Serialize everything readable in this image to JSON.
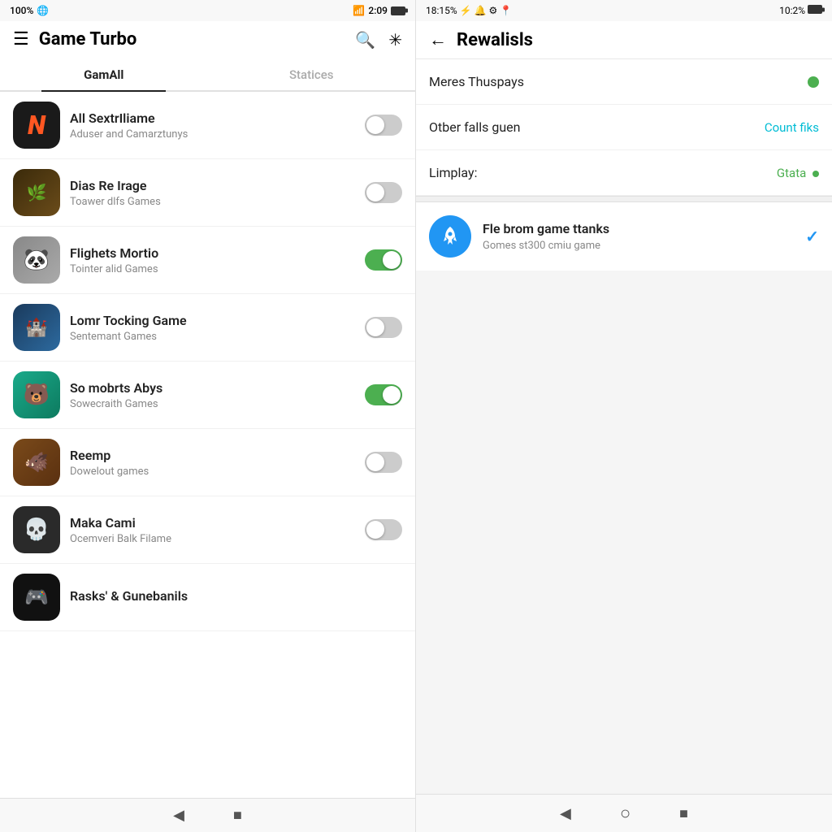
{
  "left": {
    "status_bar": {
      "percent": "100%",
      "signal_icons": "🌐",
      "right_time": "2:09",
      "battery": "■"
    },
    "header": {
      "title": "Game Turbo",
      "hamburger": "☰",
      "search_icon": "🔍",
      "settings_icon": "✳"
    },
    "tabs": [
      {
        "label": "GamAll",
        "active": true
      },
      {
        "label": "Statices",
        "active": false
      }
    ],
    "games": [
      {
        "name": "All SextrIliame",
        "developer": "Aduser and Camarztunys",
        "toggle": false,
        "icon_char": "N",
        "icon_class": "game-icon-1"
      },
      {
        "name": "Dias Re Irage",
        "developer": "Toawer dlfs Games",
        "toggle": false,
        "icon_char": "🌿",
        "icon_class": "game-icon-2"
      },
      {
        "name": "Flighets Mortio",
        "developer": "Tointer alid Games",
        "toggle": true,
        "icon_char": "🐼",
        "icon_class": "game-icon-3"
      },
      {
        "name": "Lomr Tocking Game",
        "developer": "Sentemant Games",
        "toggle": false,
        "icon_char": "🏰",
        "icon_class": "game-icon-4"
      },
      {
        "name": "So mobrts Abys",
        "developer": "Sowecraith Games",
        "toggle": true,
        "icon_char": "🐻",
        "icon_class": "game-icon-5"
      },
      {
        "name": "Reemp",
        "developer": "Dowelout games",
        "toggle": false,
        "icon_char": "🐗",
        "icon_class": "game-icon-6"
      },
      {
        "name": "Maka Cami",
        "developer": "Ocemveri Balk Filame",
        "toggle": false,
        "icon_char": "💀",
        "icon_class": "panda-icon"
      },
      {
        "name": "Rasks' & Gunebanils",
        "developer": "",
        "toggle": false,
        "icon_char": "🎮",
        "icon_class": "game-icon-7"
      }
    ],
    "nav": {
      "back": "◀",
      "home": "■"
    }
  },
  "right": {
    "status_bar": {
      "time": "18:15%",
      "icons": "⚡ 🔋 ⚙",
      "right_time": "10:2%",
      "battery": "■"
    },
    "header": {
      "back_icon": "←",
      "title": "Rewalisls"
    },
    "settings": [
      {
        "label": "Meres Thuspays",
        "value_type": "dot_green",
        "value": ""
      },
      {
        "label": "Otber falls guen",
        "value_type": "teal_text",
        "value": "Count fiks"
      },
      {
        "label": "Limplay:",
        "value_type": "green_text_dot",
        "value": "Gtata"
      }
    ],
    "reward_item": {
      "title": "Fle brom game ttanks",
      "subtitle": "Gomes st300 cmiu game",
      "chevron": "✓"
    },
    "nav": {
      "back": "◀",
      "circle": "○",
      "square": "■"
    }
  }
}
